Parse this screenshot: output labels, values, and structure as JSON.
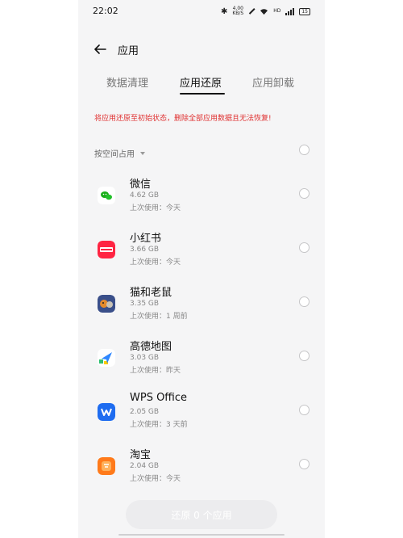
{
  "status_bar": {
    "time": "22:02",
    "net_speed_value": "4.00",
    "net_speed_unit": "KB/S",
    "signal_label": "HD",
    "battery": "15"
  },
  "header": {
    "title": "应用"
  },
  "tabs": [
    {
      "label": "数据清理",
      "active": false
    },
    {
      "label": "应用还原",
      "active": true
    },
    {
      "label": "应用卸载",
      "active": false
    }
  ],
  "warning": "将应用还原至初始状态，删除全部应用数据且无法恢复!",
  "sort": {
    "label": "按空间占用"
  },
  "apps": [
    {
      "name": "微信",
      "size": "4.62 GB",
      "last_used": "上次使用：今天",
      "icon": "wechat-icon",
      "color": "#1aad19"
    },
    {
      "name": "小红书",
      "size": "3.66 GB",
      "last_used": "上次使用：今天",
      "icon": "xiaohongshu-icon",
      "color": "#ff2442"
    },
    {
      "name": "猫和老鼠",
      "size": "3.35 GB",
      "last_used": "上次使用：1 周前",
      "icon": "tom-and-jerry-icon",
      "color": "#e58a2b"
    },
    {
      "name": "高德地图",
      "size": "3.03 GB",
      "last_used": "上次使用：昨天",
      "icon": "amap-icon",
      "color": "#2f88ff"
    },
    {
      "name": "WPS Office",
      "size": "2.05 GB",
      "last_used": "上次使用：3 天前",
      "icon": "wps-icon",
      "color": "#1e6cf0"
    },
    {
      "name": "淘宝",
      "size": "2.04 GB",
      "last_used": "上次使用：今天",
      "icon": "taobao-icon",
      "color": "#ff7a1a"
    }
  ],
  "restore_button": {
    "label": "还原 0 个应用"
  },
  "colors": {
    "warning": "#e03131",
    "accent": "#111111",
    "button_disabled": "#ececee"
  }
}
